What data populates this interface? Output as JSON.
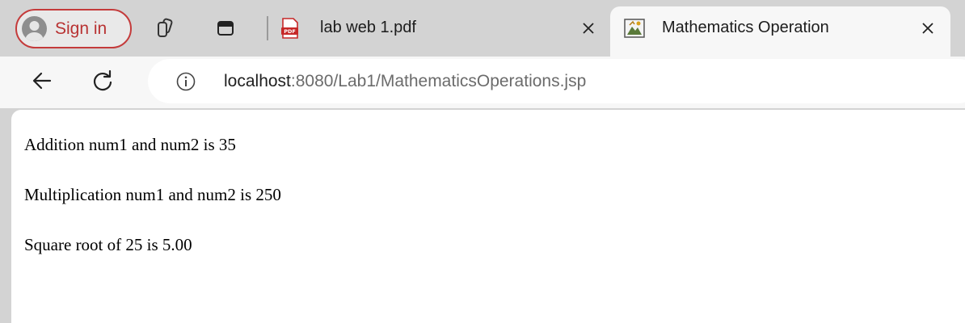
{
  "browser": {
    "profile": {
      "label": "Sign in",
      "avatar_icon": "person-avatar-icon"
    },
    "tabstrip_buttons": [
      {
        "name": "workspaces-button",
        "icon": "workspaces-icon"
      },
      {
        "name": "tab-actions-button",
        "icon": "tab-actions-icon"
      }
    ],
    "tabs": [
      {
        "title": "lab web 1.pdf",
        "icon": "pdf-file-icon",
        "active": false
      },
      {
        "title": "Mathematics Operation",
        "icon": "page-favicon-icon",
        "active": true
      }
    ],
    "address_bar": {
      "host": "localhost",
      "rest": ":8080/Lab1/MathematicsOperations.jsp",
      "info_icon": "info-icon"
    },
    "nav": {
      "back_icon": "arrow-left-icon",
      "reload_icon": "reload-icon"
    }
  },
  "page": {
    "lines": [
      "Addition num1 and num2 is 35",
      "Multiplication num1 and num2 is 250",
      "Square root of 25 is 5.00"
    ]
  },
  "colors": {
    "chrome_background": "#d3d3d3",
    "toolbar_background": "#f7f7f7",
    "signin_accent": "#c43b3b"
  }
}
